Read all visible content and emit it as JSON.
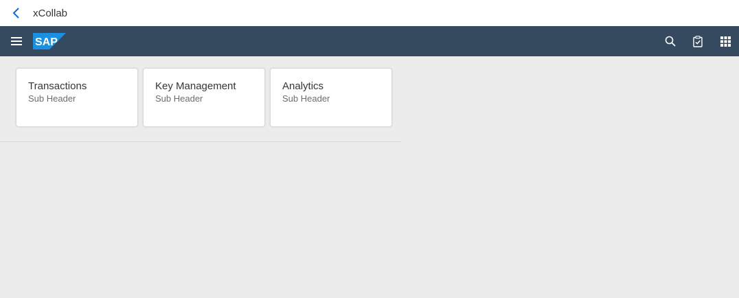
{
  "titlebar": {
    "title": "xCollab",
    "back_icon": "chevron-left-icon"
  },
  "shellbar": {
    "logo_text": "SAP",
    "menu_icon": "hamburger-menu-icon",
    "actions": [
      {
        "icon": "search-icon"
      },
      {
        "icon": "clipboard-check-icon"
      },
      {
        "icon": "grid-apps-icon"
      }
    ],
    "colors": {
      "background": "#354a5f",
      "logo_blue": "#1b8fe0"
    }
  },
  "tiles": [
    {
      "title": "Transactions",
      "subtitle": "Sub Header"
    },
    {
      "title": "Key Management",
      "subtitle": "Sub Header"
    },
    {
      "title": "Analytics",
      "subtitle": "Sub Header"
    }
  ]
}
